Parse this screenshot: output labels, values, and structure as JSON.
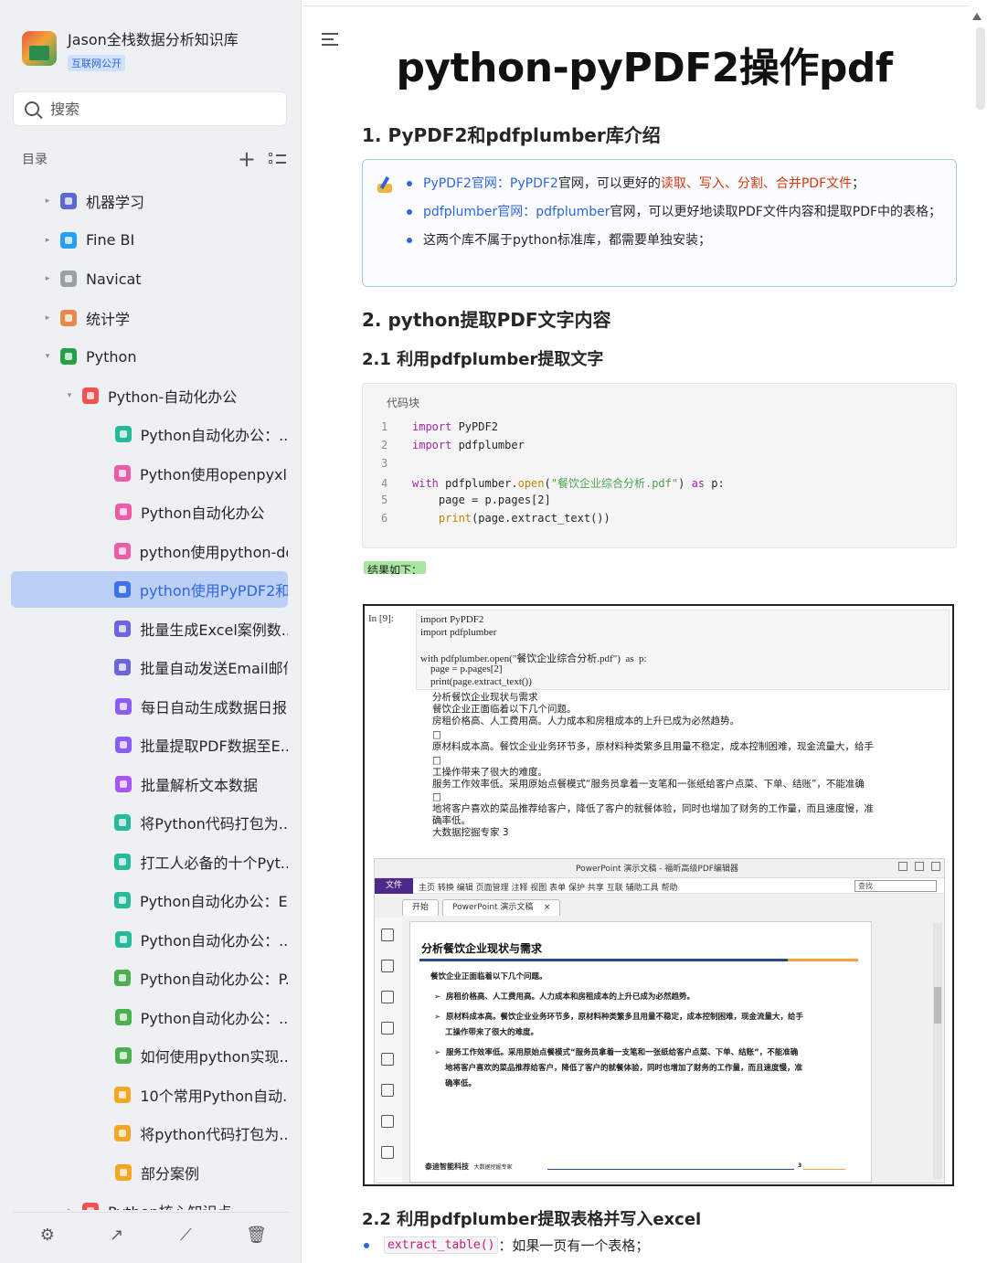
{
  "sidebar": {
    "brand_title": "Jason全栈数据分析知识库",
    "brand_tag": "互联网公开",
    "search_placeholder": "搜索",
    "toc_title": "目录",
    "items": [
      {
        "label": "机器学习",
        "level": 0,
        "caret": "▸",
        "color": "#5a6acf"
      },
      {
        "label": "Fine BI",
        "level": 0,
        "caret": "▸",
        "color": "#2a9df4"
      },
      {
        "label": "Navicat",
        "level": 0,
        "caret": "▸",
        "color": "#9aa0a6"
      },
      {
        "label": "统计学",
        "level": 0,
        "caret": "▸",
        "color": "#e58a4e"
      },
      {
        "label": "Python",
        "level": 0,
        "caret": "▾",
        "color": "#24a148"
      },
      {
        "label": "Python-自动化办公",
        "level": 1,
        "caret": "▾",
        "color": "#ef5350"
      },
      {
        "label": "Python自动化办公：...",
        "level": 2,
        "caret": "",
        "color": "#26b99a"
      },
      {
        "label": "Python使用openpyxl...",
        "level": 2,
        "caret": "",
        "color": "#ec5ca8"
      },
      {
        "label": "Python自动化办公",
        "level": 2,
        "caret": "",
        "color": "#ec5ca8"
      },
      {
        "label": "python使用python-do...",
        "level": 2,
        "caret": "",
        "color": "#ec5ca8"
      },
      {
        "label": "python使用PyPDF2和...",
        "level": 2,
        "caret": "",
        "color": "#3b73e8",
        "active": true
      },
      {
        "label": "批量生成Excel案例数...",
        "level": 2,
        "caret": "",
        "color": "#6c63e0"
      },
      {
        "label": "批量自动发送Email邮件",
        "level": 2,
        "caret": "",
        "color": "#6c63e0"
      },
      {
        "label": "每日自动生成数据日报",
        "level": 2,
        "caret": "",
        "color": "#8b5cf6"
      },
      {
        "label": "批量提取PDF数据至E...",
        "level": 2,
        "caret": "",
        "color": "#8b5cf6"
      },
      {
        "label": "批量解析文本数据",
        "level": 2,
        "caret": "",
        "color": "#a855f7"
      },
      {
        "label": "将Python代码打包为....",
        "level": 2,
        "caret": "",
        "color": "#26b99a"
      },
      {
        "label": "打工人必备的十个Pyt...",
        "level": 2,
        "caret": "",
        "color": "#26b99a"
      },
      {
        "label": "Python自动化办公：E...",
        "level": 2,
        "caret": "",
        "color": "#26b99a"
      },
      {
        "label": "Python自动化办公：...",
        "level": 2,
        "caret": "",
        "color": "#26b99a"
      },
      {
        "label": "Python自动化办公：P...",
        "level": 2,
        "caret": "",
        "color": "#4caf50"
      },
      {
        "label": "Python自动化办公：...",
        "level": 2,
        "caret": "",
        "color": "#4caf50"
      },
      {
        "label": "如何使用python实现...",
        "level": 2,
        "caret": "",
        "color": "#4caf50"
      },
      {
        "label": "10个常用Python自动...",
        "level": 2,
        "caret": "",
        "color": "#f5a623"
      },
      {
        "label": "将python代码打包为....",
        "level": 2,
        "caret": "",
        "color": "#f5a623"
      },
      {
        "label": "部分案例",
        "level": 2,
        "caret": "",
        "color": "#f5a623"
      },
      {
        "label": "Python核心知识点",
        "level": 1,
        "caret": "▸",
        "color": "#ef5350"
      }
    ]
  },
  "doc": {
    "title": "python-pyPDF2操作pdf",
    "h2_1": "1. PyPDF2和pdfplumber库介绍",
    "callout": {
      "b1_link": "PyPDF2官网：",
      "b1_name": "PyPDF2",
      "b1_text": "官网，可以更好的",
      "b1_red": "读取、写入、分割、合并PDF文件",
      "b1_end": "；",
      "b2_link": "pdfplumber官网：",
      "b2_name": "pdfplumber",
      "b2_text": "官网，可以更好地读取PDF文件内容和提取PDF中的表格；",
      "b3_text": "这两个库不属于python标准库，都需要单独安装；"
    },
    "h2_2": "2. python提取PDF文字内容",
    "h3_1": "2.1 利用pdfplumber提取文字",
    "code_caption": "代码块",
    "code": {
      "l1_kw": "import",
      "l1_rest": " PyPDF2",
      "l2_kw": "import",
      "l2_rest": " pdfplumber",
      "l4_kw": "with",
      "l4_a": " pdfplumber.",
      "l4_fn": "open",
      "l4_p": "(",
      "l4_str": "\"餐饮企业综合分析.pdf\"",
      "l4_b": ") ",
      "l4_as": "as",
      "l4_c": " p:",
      "l5": "    page = p.pages[2]",
      "l6_fn": "print",
      "l6_rest": "(page.extract_text())"
    },
    "result_label": "结果如下：",
    "notebook": {
      "prompt": "In  [9]:",
      "c1": "import PyPDF2",
      "c2": "import pdfplumber",
      "c3": "with pdfplumber.open(\"餐饮企业综合分析.pdf\")  as  p:",
      "c4": "    page = p.pages[2]",
      "c5": "    print(page.extract_text())",
      "out": [
        "分析餐饮企业现状与需求",
        "餐饮企业正面临着以下几个问题。",
        "房租价格高、人工费用高。人力成本和房租成本的上升已成为必然趋势。",
        "□",
        "原材料成本高。餐饮企业业务环节多，原材料种类繁多且用量不稳定，成本控制困难，现金流量大，给手",
        "□",
        "工操作带来了很大的难度。",
        "服务工作效率低。采用原始点餐模式“服务员拿着一支笔和一张纸给客户点菜、下单、结账”，不能准确",
        "□",
        "地将客户喜欢的菜品推荐给客户，降低了客户的就餐体验，同时也增加了财务的工作量，而且速度慢，准",
        "确率低。",
        "大数据挖掘专家  3"
      ]
    },
    "pdf": {
      "window_title": "PowerPoint 演示文稿 - 福昕高级PDF编辑器",
      "file_tab": "文件",
      "menu": "主页  转换  编辑  页面管理  注释  视图  表单  保护  共享  互联  辅助工具  帮助",
      "search": "查找",
      "tab1": "开始",
      "tab2": "PowerPoint 演示文稿",
      "tab_close": "×",
      "heading": "分析餐饮企业现状与需求",
      "p1": "餐饮企业正面临着以下几个问题。",
      "p2": "房租价格高、人工费用高。人力成本和房租成本的上升已成为必然趋势。",
      "p3a": "原材料成本高。餐饮企业业务环节多，原材料种类繁多且用量不稳定，成本控制困难，现金流量大，给手",
      "p3b": "工操作带来了很大的难度。",
      "p4a": "服务工作效率低。采用原始点餐模式“服务员拿着一支笔和一张纸给客户点菜、下单、结账”，不能准确",
      "p4b": "地将客户喜欢的菜品推荐给客户，降低了客户的就餐体验，同时也增加了财务的工作量，而且速度慢，准",
      "p4c": "确率低。",
      "footer_logo": "泰迪智能科技",
      "footer_sub": "大数据挖掘专家",
      "page_num": "3"
    },
    "h3_2": "2.2 利用pdfplumber提取表格并写入excel",
    "bullet_code": "extract_table()",
    "bullet_text": "：如果一页有一个表格；"
  },
  "colors": {
    "accent": "#2f66e0",
    "sidebar_bg": "#eef0f3",
    "active_bg": "#bcd0f7",
    "callout_border": "#a9c6ee"
  }
}
